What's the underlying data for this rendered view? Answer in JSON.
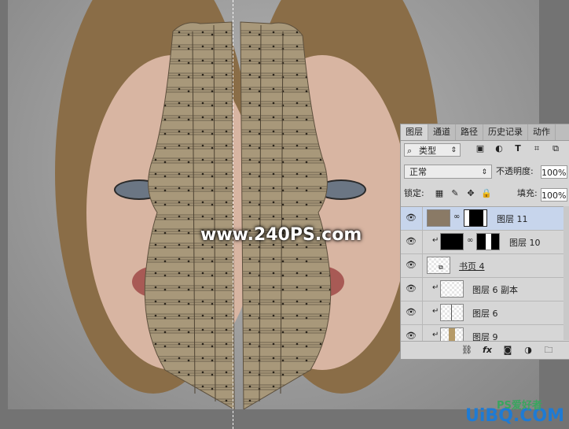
{
  "panel": {
    "tabs": [
      "图层",
      "通道",
      "路径",
      "历史记录",
      "动作"
    ],
    "filter": {
      "label": "类型",
      "search_icon": "search-icon",
      "arrow": "⇕"
    },
    "filter_icons": [
      "image-filter-icon",
      "adjustment-filter-icon",
      "type-filter-icon",
      "shape-filter-icon",
      "smart-object-filter-icon"
    ],
    "blend_mode": "正常",
    "opacity_label": "不透明度:",
    "opacity_value": "100%",
    "lock_label": "锁定:",
    "fill_label": "填充:",
    "fill_value": "100%",
    "layers": [
      {
        "name": "图层 11",
        "selected": true
      },
      {
        "name": "图层 10",
        "clipped": true
      },
      {
        "name": "书页 4"
      },
      {
        "name": "图层 6 副本",
        "clipped": true
      },
      {
        "name": "图层 6",
        "clipped": true
      },
      {
        "name": "图层 9",
        "clipped": true
      }
    ],
    "bottom_icons": [
      "link-icon",
      "fx-icon",
      "mask-icon",
      "adjustment-icon",
      "folder-icon"
    ]
  },
  "watermark": "www.240PS.com",
  "corner_logo": {
    "main": "UiBQ.COM",
    "sub": "PS爱好者"
  },
  "colors": {
    "selected_row": "#c7d5ec",
    "panel_bg": "#d6d6d6",
    "logo_blue": "#1e7bd4"
  }
}
